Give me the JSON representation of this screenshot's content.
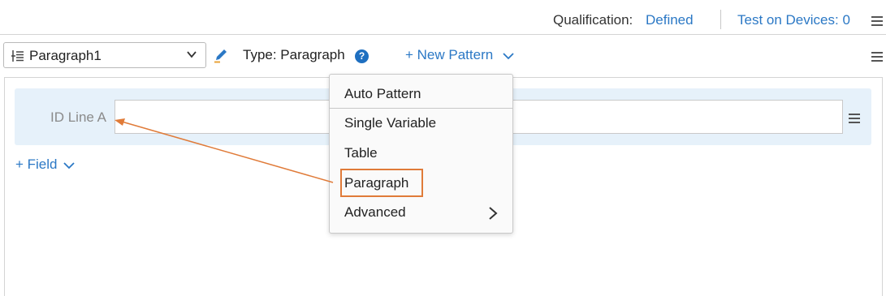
{
  "header": {
    "qualification_label": "Qualification:",
    "qualification_value": "Defined",
    "test_devices_label": "Test on Devices: 0",
    "menu_icon": "hamburger-icon"
  },
  "toolbar": {
    "pattern_select_value": "Paragraph1",
    "pattern_select_icon": "paragraph-tree-icon",
    "edit_icon": "pencil-icon",
    "type_label": "Type: Paragraph",
    "help_icon": "question-icon",
    "new_pattern_label": "+ New Pattern",
    "menu_icon": "hamburger-icon"
  },
  "fields": [
    {
      "label": "ID Line A",
      "value": ""
    }
  ],
  "add_field_label": "+ Field",
  "new_pattern_menu": {
    "items": [
      "Auto Pattern",
      "Single Variable",
      "Table",
      "Paragraph",
      "Advanced"
    ],
    "highlighted_item": "Paragraph",
    "submenu_item": "Advanced"
  },
  "colors": {
    "link": "#2b78c5",
    "field_row_bg": "#e6f1fa",
    "annotation": "#e07b39",
    "help_icon": "#1e6fc0"
  }
}
